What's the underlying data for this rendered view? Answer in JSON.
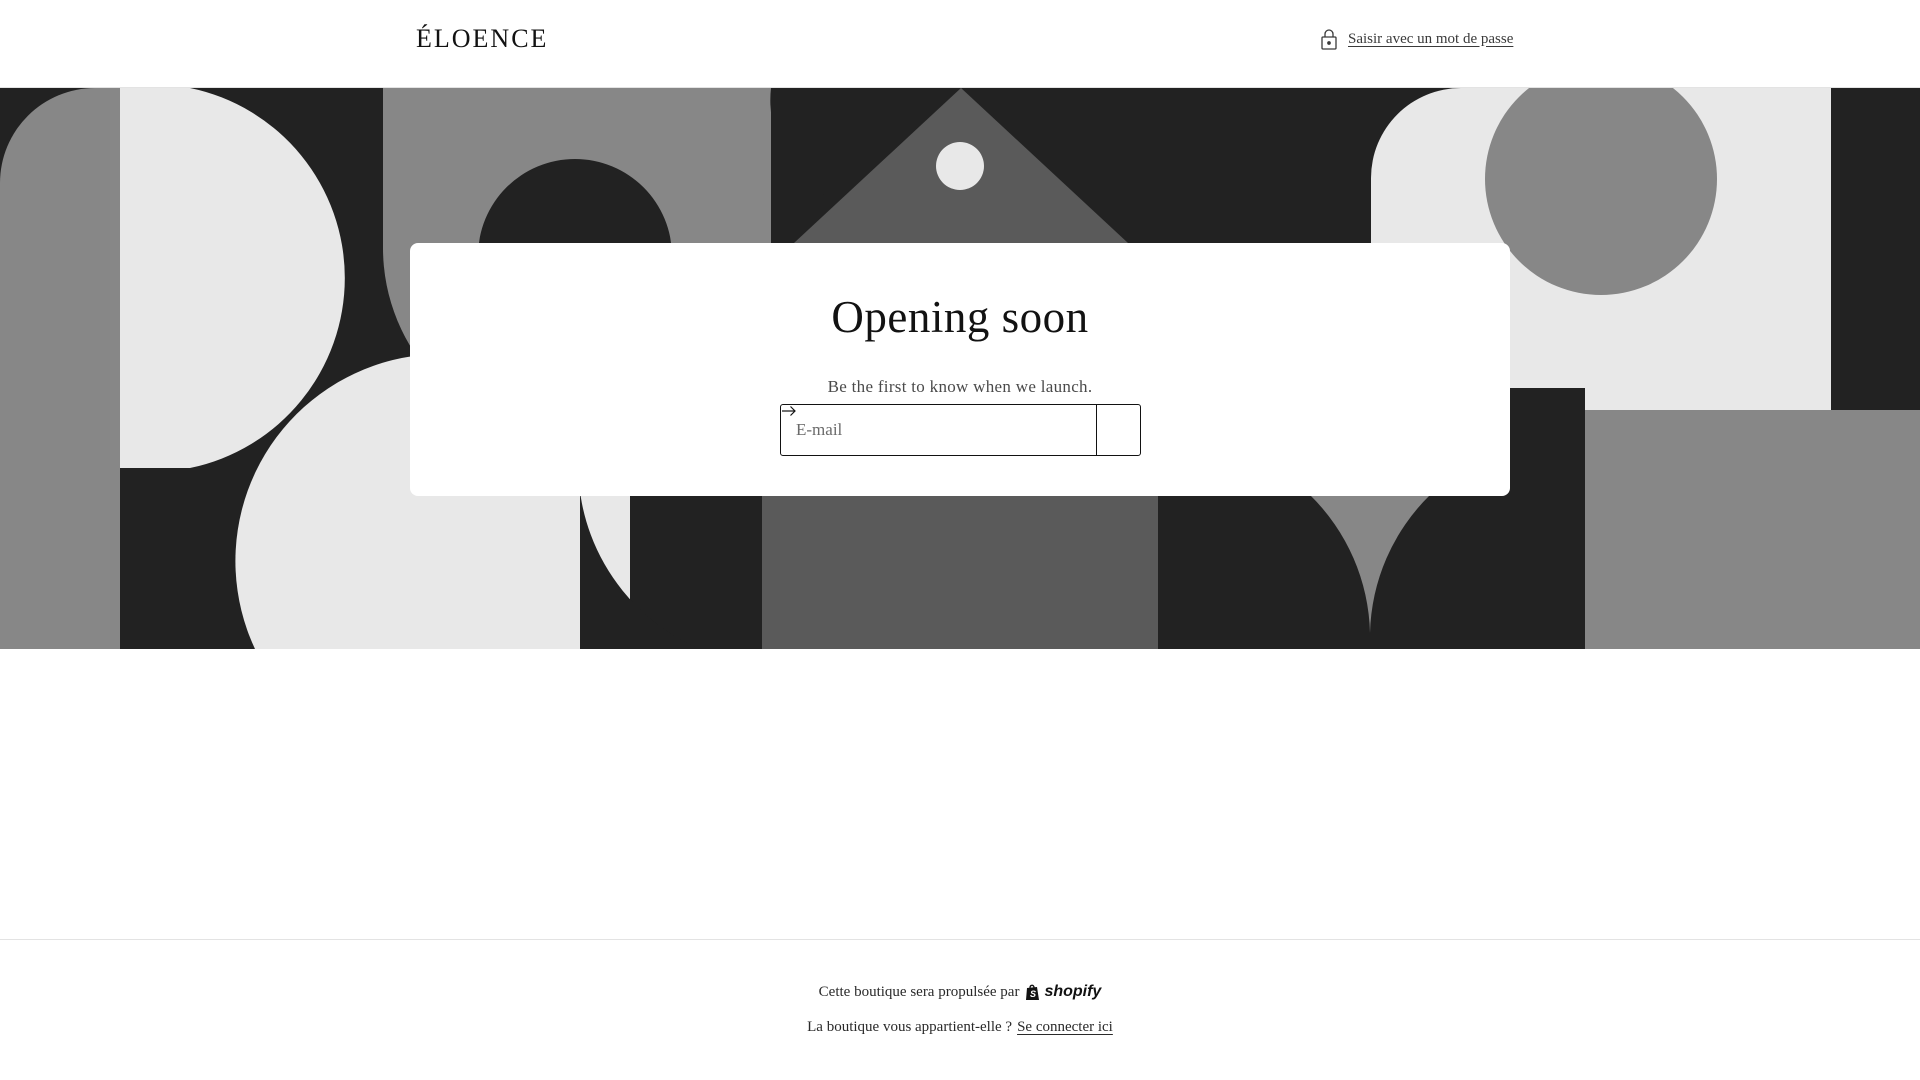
{
  "header": {
    "logo": "ÉLOENCE",
    "password_link": "Saisir avec un mot de passe",
    "lock_icon": "lock-icon"
  },
  "hero": {
    "colors": {
      "dark": "#222222",
      "mid": "#878787",
      "deep": "#5a5a5a",
      "light": "#e8e8e8"
    }
  },
  "card": {
    "title": "Opening soon",
    "subtitle": "Be the first to know when we launch.",
    "email_placeholder": "E-mail",
    "submit_icon": "arrow-right-icon"
  },
  "footer": {
    "powered_text": "Cette boutique sera propulsée par",
    "shopify_label": "shopify",
    "owner_text": "La boutique vous appartient-elle ?",
    "login_link": "Se connecter ici"
  }
}
